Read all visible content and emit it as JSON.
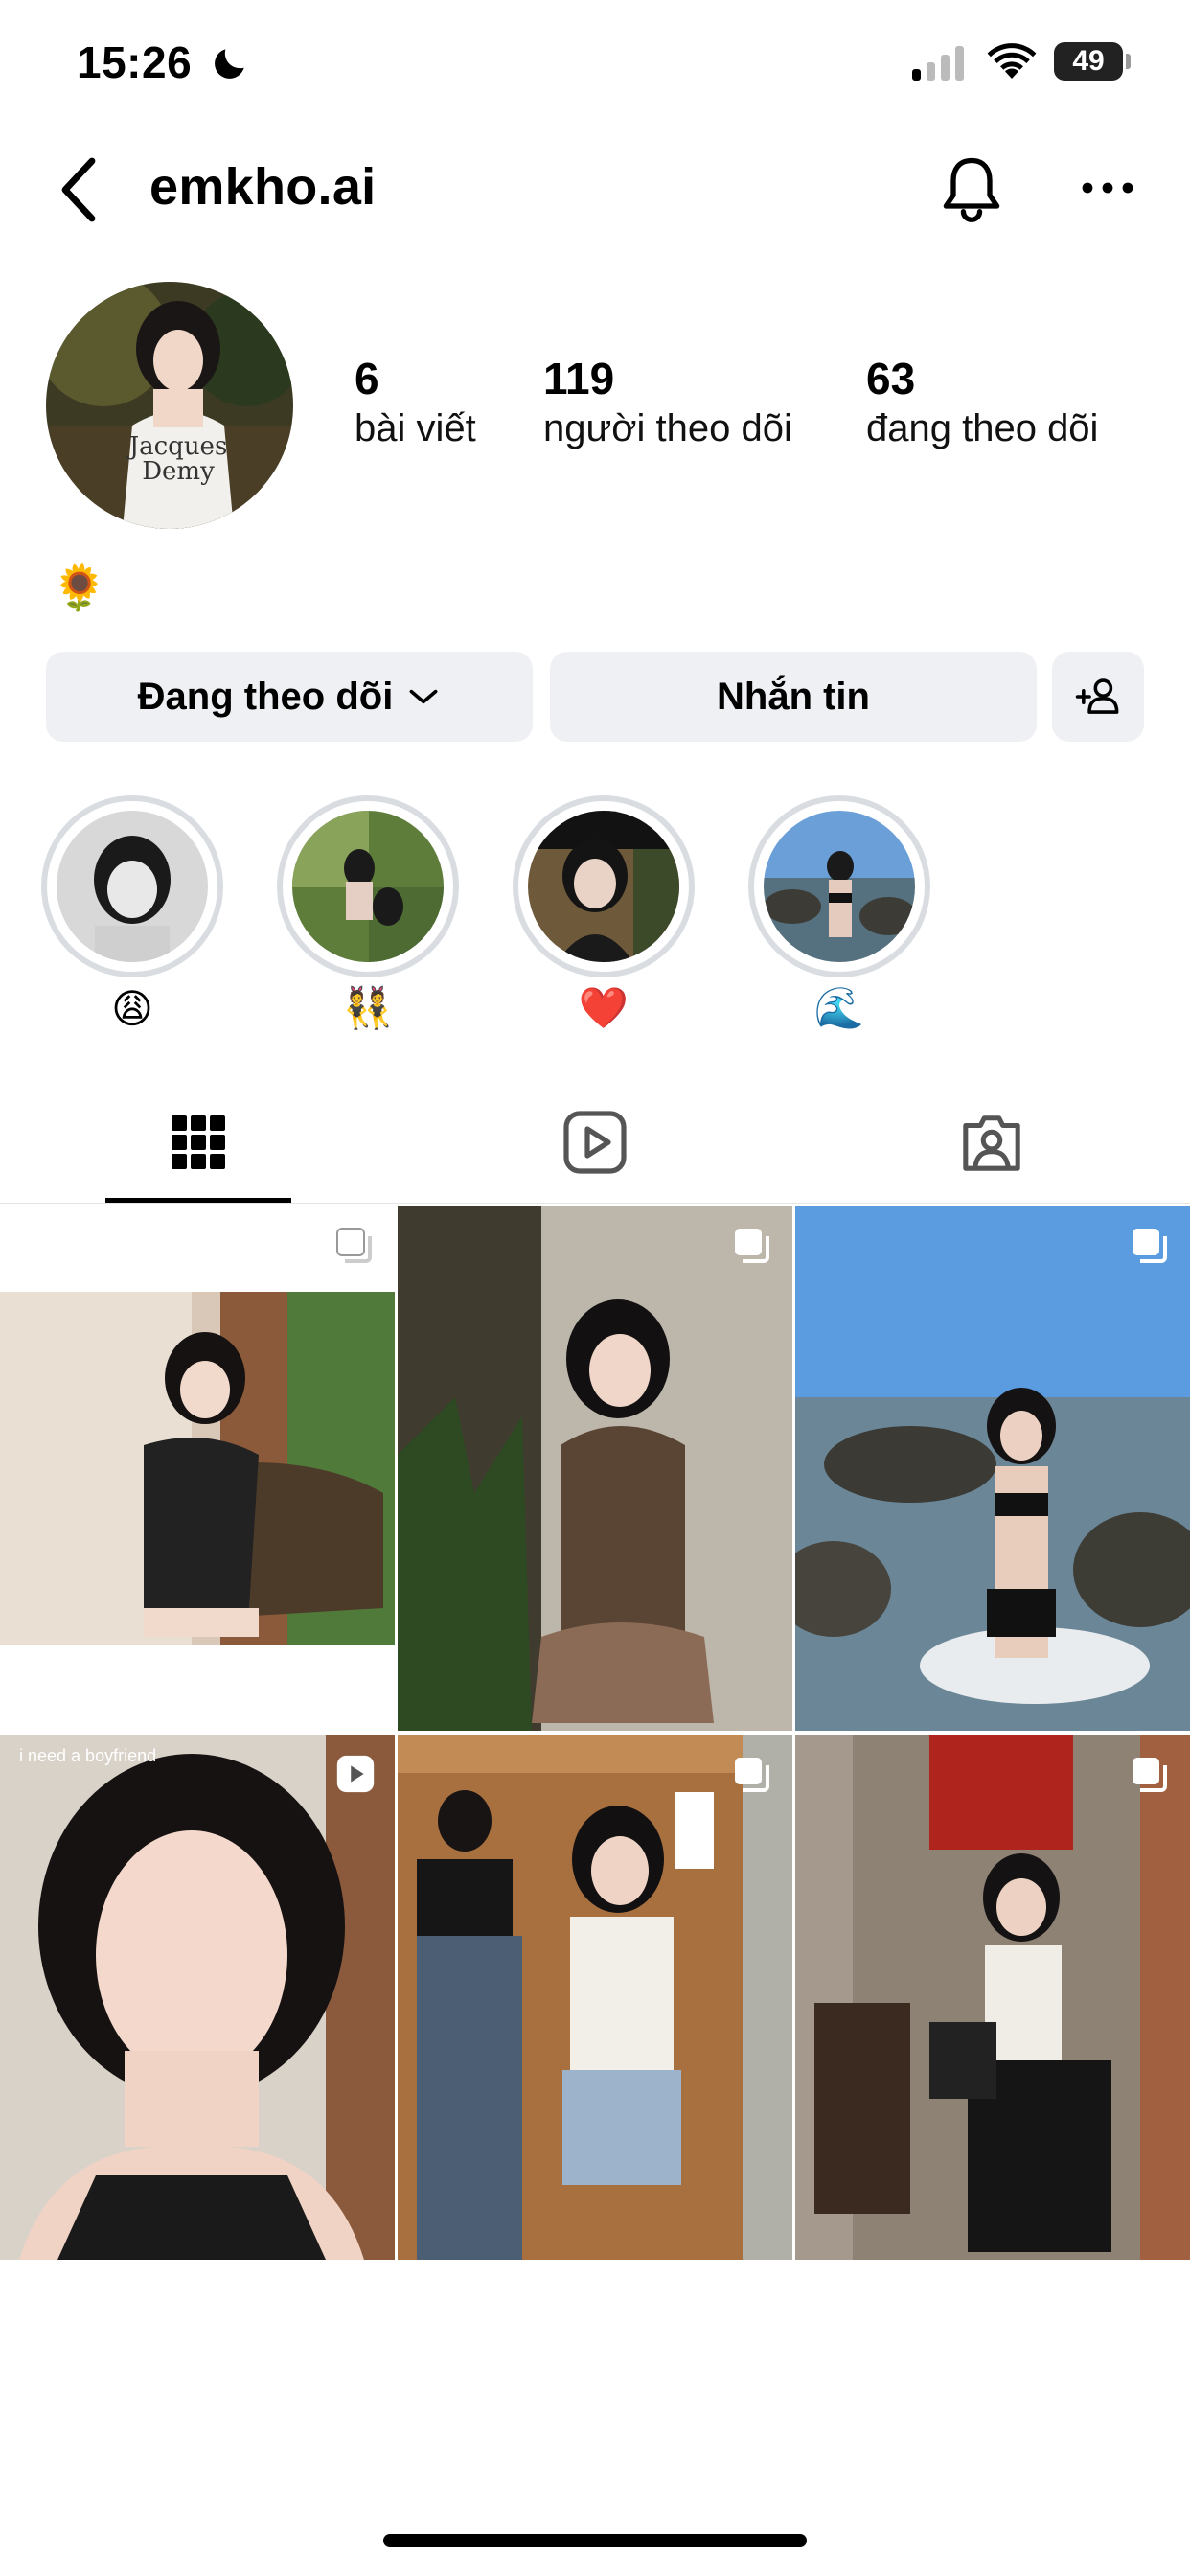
{
  "status_bar": {
    "time": "15:26",
    "battery": "49"
  },
  "header": {
    "username": "emkho.ai"
  },
  "profile": {
    "stats": [
      {
        "count": "6",
        "label": "bài viết"
      },
      {
        "count": "119",
        "label": "người theo dõi"
      },
      {
        "count": "63",
        "label": "đang theo dõi"
      }
    ],
    "bio": "🌻"
  },
  "actions": {
    "following_label": "Đang theo dõi",
    "message_label": "Nhắn tin"
  },
  "highlights": [
    {
      "label": "😩"
    },
    {
      "label": "👯"
    },
    {
      "label": "❤️"
    },
    {
      "label": "🌊"
    }
  ],
  "tabs": [
    {
      "icon": "grid-icon",
      "active": true
    },
    {
      "icon": "reels-icon",
      "active": false
    },
    {
      "icon": "tagged-icon",
      "active": false
    }
  ],
  "posts": [
    {
      "overlay": "carousel-icon"
    },
    {
      "overlay": "carousel-icon"
    },
    {
      "overlay": "carousel-icon"
    },
    {
      "overlay": "reel-icon",
      "caption": "i need a boyfriend"
    },
    {
      "overlay": "carousel-icon"
    },
    {
      "overlay": "carousel-icon"
    }
  ]
}
